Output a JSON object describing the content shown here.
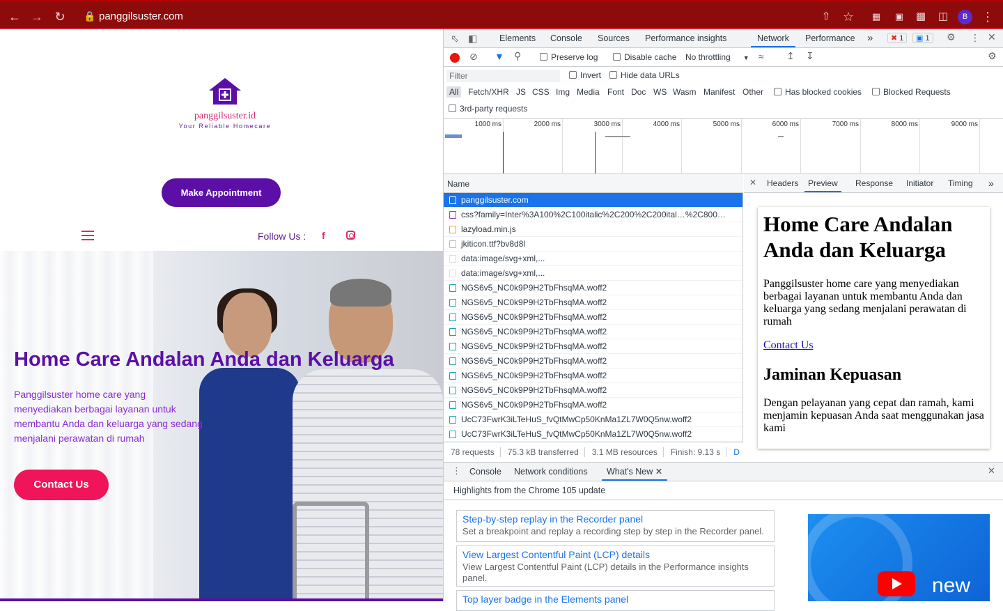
{
  "browser": {
    "url": "panggilsuster.com",
    "avatar_letter": "B"
  },
  "site": {
    "logo_name": "panggilsuster.id",
    "logo_tagline": "Your Reliable Homecare",
    "appointment_button": "Make Appointment",
    "follow_label": "Follow Us :",
    "facebook_icon": "f",
    "hero_title": "Home Care Andalan Anda dan Keluarga",
    "hero_body": "Panggilsuster home care yang menyediakan berbagai layanan untuk membantu Anda dan keluarga yang sedang menjalani perawatan di rumah",
    "contact_button": "Contact Us",
    "colors": {
      "primary": "#5b0fa6",
      "accent": "#f0145a"
    }
  },
  "devtools": {
    "main_tabs": [
      "Elements",
      "Console",
      "Sources",
      "Performance insights",
      "Network",
      "Performance"
    ],
    "active_tab": "Network",
    "more_tabs": "»",
    "error_count": "1",
    "message_count": "1",
    "toolbar": {
      "preserve_log": "Preserve log",
      "disable_cache": "Disable cache",
      "throttling": "No throttling"
    },
    "filter": {
      "placeholder": "Filter",
      "invert": "Invert",
      "hide_data_urls": "Hide data URLs",
      "types": [
        "All",
        "Fetch/XHR",
        "JS",
        "CSS",
        "Img",
        "Media",
        "Font",
        "Doc",
        "WS",
        "Wasm",
        "Manifest",
        "Other"
      ],
      "has_blocked_cookies": "Has blocked cookies",
      "blocked_requests": "Blocked Requests",
      "third_party": "3rd-party requests"
    },
    "timeline_ticks": [
      "1000 ms",
      "2000 ms",
      "3000 ms",
      "4000 ms",
      "5000 ms",
      "6000 ms",
      "7000 ms",
      "8000 ms",
      "9000 ms"
    ],
    "name_header": "Name",
    "requests": [
      "panggilsuster.com",
      "css?family=Inter%3A100%2C100italic%2C200%2C200ital…%2C800…",
      "lazyload.min.js",
      "jkiticon.ttf?bv8d8l",
      "data:image/svg+xml,...",
      "data:image/svg+xml,...",
      "NGS6v5_NC0k9P9H2TbFhsqMA.woff2",
      "NGS6v5_NC0k9P9H2TbFhsqMA.woff2",
      "NGS6v5_NC0k9P9H2TbFhsqMA.woff2",
      "NGS6v5_NC0k9P9H2TbFhsqMA.woff2",
      "NGS6v5_NC0k9P9H2TbFhsqMA.woff2",
      "NGS6v5_NC0k9P9H2TbFhsqMA.woff2",
      "NGS6v5_NC0k9P9H2TbFhsqMA.woff2",
      "NGS6v5_NC0k9P9H2TbFhsqMA.woff2",
      "NGS6v5_NC0k9P9H2TbFhsqMA.woff2",
      "UcC73FwrK3iLTeHuS_fvQtMwCp50KnMa1ZL7W0Q5nw.woff2",
      "UcC73FwrK3iLTeHuS_fvQtMwCp50KnMa1ZL7W0Q5nw.woff2"
    ],
    "status": {
      "requests": "78 requests",
      "transferred": "75.3 kB transferred",
      "resources": "3.1 MB resources",
      "finish": "Finish: 9.13 s",
      "extra": "D"
    },
    "detail_tabs": [
      "Headers",
      "Preview",
      "Response",
      "Initiator",
      "Timing"
    ],
    "detail_active": "Preview",
    "preview": {
      "h1": "Home Care Andalan Anda dan Keluarga",
      "p1": "Panggilsuster home care yang menyediakan berbagai layanan untuk membantu Anda dan keluarga yang sedang menjalani perawatan di rumah",
      "link": "Contact Us",
      "h2": "Jaminan Kepuasan",
      "p2": "Dengan pelayanan yang cepat dan ramah, kami menjamin kepuasan Anda saat menggunakan jasa kami"
    },
    "drawer_tabs": [
      "Console",
      "Network conditions",
      "What's New"
    ],
    "drawer_active": "What's New",
    "drawer_header": "Highlights from the Chrome 105 update",
    "cards": [
      {
        "title": "Step-by-step replay in the Recorder panel",
        "desc": "Set a breakpoint and replay a recording step by step in the Recorder panel."
      },
      {
        "title": "View Largest Contentful Paint (LCP) details",
        "desc": "View Largest Contentful Paint (LCP) details in the Performance insights panel."
      },
      {
        "title": "Top layer badge in the Elements panel",
        "desc": ""
      }
    ],
    "video_label": "new"
  }
}
